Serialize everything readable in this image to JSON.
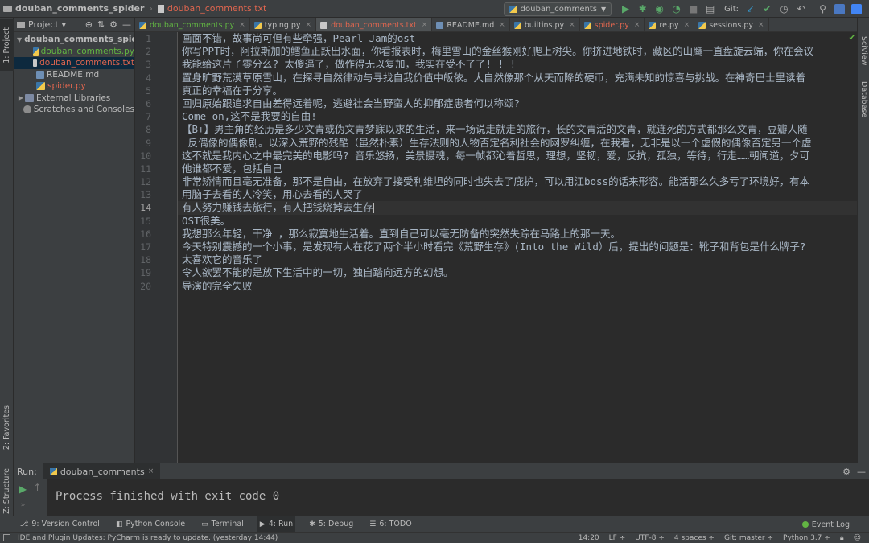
{
  "navbar": {
    "project": "douban_comments_spider",
    "file": "douban_comments.txt",
    "run_config": "douban_comments",
    "git_label": "Git:"
  },
  "left_stripe": {
    "project_tab": "1: Project",
    "structure_tab": "Z: Structure",
    "favorites_tab": "2: Favorites"
  },
  "right_stripe": {
    "sciview_tab": "SciView",
    "database_tab": "Database"
  },
  "project_panel": {
    "title": "Project",
    "tree": [
      {
        "label": "douban_comments_spider",
        "type": "folder",
        "color": "plain",
        "bold": true
      },
      {
        "label": "douban_comments.py",
        "type": "py",
        "color": "green"
      },
      {
        "label": "douban_comments.txt",
        "type": "txt",
        "color": "red",
        "selected": true
      },
      {
        "label": "README.md",
        "type": "md",
        "color": "plain"
      },
      {
        "label": "spider.py",
        "type": "py",
        "color": "red"
      },
      {
        "label": "External Libraries",
        "type": "lib",
        "color": "plain"
      },
      {
        "label": "Scratches and Consoles",
        "type": "scratch",
        "color": "plain"
      }
    ]
  },
  "editor_tabs": [
    {
      "label": "douban_comments.py",
      "color": "#62b543",
      "icon": "py"
    },
    {
      "label": "typing.py",
      "color": "#bbbbbb",
      "icon": "py"
    },
    {
      "label": "douban_comments.txt",
      "color": "#e0664f",
      "icon": "txt",
      "active": true
    },
    {
      "label": "README.md",
      "color": "#bbbbbb",
      "icon": "md"
    },
    {
      "label": "builtins.py",
      "color": "#bbbbbb",
      "icon": "py"
    },
    {
      "label": "spider.py",
      "color": "#e0664f",
      "icon": "py"
    },
    {
      "label": "re.py",
      "color": "#bbbbbb",
      "icon": "py"
    },
    {
      "label": "sessions.py",
      "color": "#bbbbbb",
      "icon": "py"
    }
  ],
  "editor": {
    "current_line": 14,
    "lines": [
      "画面不错，故事尚可但有些牵强，Pearl Jam的ost",
      "你写PPT时，阿拉斯加的鳕鱼正跃出水面，你看报表时，梅里雪山的金丝猴刚好爬上树尖。你挤进地铁时，藏区的山鹰一直盘旋云端，你在会议",
      "我能给这片子零分么? 太傻逼了，做作得无以复加，我实在受不了了! ! !",
      "置身旷野荒漠草原雪山，在探寻自然律动与寻找自我价值中皈依。大自然像那个从天而降的硬币，充满未知的惊喜与挑战。在神奇巴士里读着",
      "真正的幸福在于分享。",
      "回归原始跟追求自由差得远着呢，逃避社会当野蛮人的抑郁症患者何以称颂?",
      "Come on,这不是我要的自由!",
      "【B+】男主角的经历是多少文青或伪文青梦寐以求的生活，来一场说走就走的旅行，长的文青活的文青，就连死的方式都那么文青，豆瓣人随",
      " 反偶像的偶像剧。以深入荒野的残酷（虽然朴素）生存法则的人物否定名利社会的网罗纠缠，在我看，无非是以一个虚假的偶像否定另一个虚",
      "这不就是我内心之中最完美的电影吗? 音乐悠扬，美景摄魂，每一帧都沁着哲思，理想，坚韧，爱，反抗，孤独，等待，行走……朝闻道，夕可",
      "他谁都不爱，包括自己",
      "非常矫情而且毫无准备，那不是自由，在放弃了接受利维坦的同时也失去了庇护，可以用江boss的话来形容。能活那么久多亏了环境好，有本",
      "用脑子去看的人冷笑，用心去看的人哭了",
      "有人努力赚钱去旅行，有人把钱烧掉去生存",
      "OST很美。",
      "我想那么年轻，干净 ，那么寂寞地生活着。直到自己可以毫无防备的突然失踪在马路上的那一天。",
      "今天特别震撼的一个小事，是发现有人在花了两个半小时看完《荒野生存》(Into the Wild）后，提出的问题是：靴子和背包是什么牌子?",
      "太喜欢它的音乐了",
      "令人欲罢不能的是放下生活中的一切，独自踏向远方的幻想。",
      "导演的完全失败"
    ]
  },
  "run_panel": {
    "label": "Run:",
    "tab": "douban_comments",
    "output": "Process finished with exit code 0"
  },
  "tool_windows": [
    {
      "label": "9: Version Control"
    },
    {
      "label": "Python Console"
    },
    {
      "label": "Terminal"
    },
    {
      "label": "4: Run",
      "active": true
    },
    {
      "label": "5: Debug"
    },
    {
      "label": "6: TODO"
    }
  ],
  "event_log": "Event Log",
  "status_bar": {
    "message": "IDE and Plugin Updates: PyCharm is ready to update. (yesterday 14:44)",
    "position": "14:20",
    "line_sep": "LF ÷",
    "encoding": "UTF-8 ÷",
    "indent": "4 spaces ÷",
    "git": "Git: master ÷",
    "interpreter": "Python 3.7 ÷"
  }
}
